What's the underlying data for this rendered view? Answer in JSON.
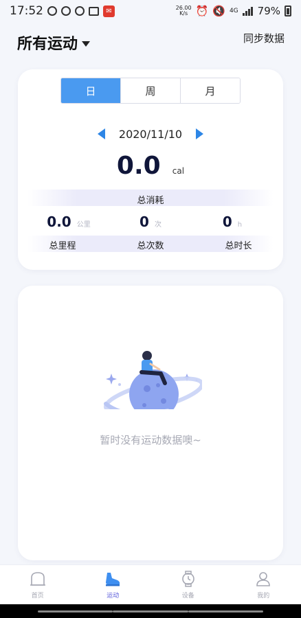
{
  "status_bar": {
    "time": "17:52",
    "speed_top": "26.00",
    "speed_bottom": "K/s",
    "signal": "4G",
    "battery": "79%"
  },
  "header": {
    "title": "所有运动",
    "sync_label": "同步数据"
  },
  "summary": {
    "tabs": [
      {
        "label": "日",
        "active": true
      },
      {
        "label": "周",
        "active": false
      },
      {
        "label": "月",
        "active": false
      }
    ],
    "date": "2020/11/10",
    "calories_value": "0.0",
    "calories_unit": "cal",
    "calories_label": "总消耗",
    "stats": [
      {
        "value": "0.0",
        "unit": "公里",
        "label": "总里程"
      },
      {
        "value": "0",
        "unit": "次",
        "label": "总次数"
      },
      {
        "value": "0",
        "unit": "h",
        "label": "总时长"
      }
    ]
  },
  "empty_state": {
    "message": "暂时没有运动数据噢~"
  },
  "bottom_nav": [
    {
      "label": "首页",
      "icon": "home-icon",
      "active": false
    },
    {
      "label": "运动",
      "icon": "shoe-icon",
      "active": true
    },
    {
      "label": "设备",
      "icon": "watch-icon",
      "active": false
    },
    {
      "label": "我的",
      "icon": "user-icon",
      "active": false
    }
  ],
  "colors": {
    "accent": "#4a9af0",
    "arrow": "#2d86e6",
    "nav_active": "#5c5edb",
    "planet": "#8ea5f0"
  }
}
